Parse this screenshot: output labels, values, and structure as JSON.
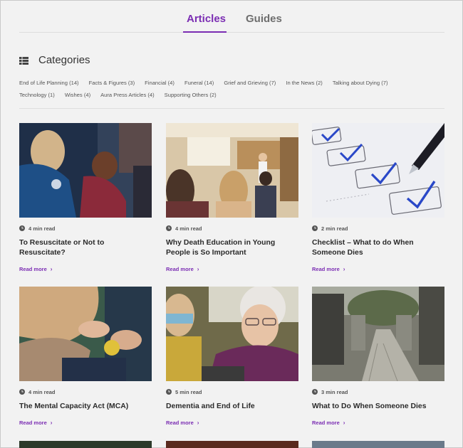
{
  "tabs": [
    {
      "label": "Articles",
      "active": true
    },
    {
      "label": "Guides",
      "active": false
    }
  ],
  "categories": {
    "title": "Categories",
    "icon": "grid-list-icon",
    "row1": [
      "End of Life Planning (14)",
      "Facts & Figures (3)",
      "Financial (4)",
      "Funeral (14)",
      "Grief and Grieving (7)",
      "In the News (2)",
      "Talking about Dying (7)"
    ],
    "row2": [
      "Technology (1)",
      "Wishes (4)",
      "Aura Press Articles (4)",
      "Supporting Others (2)"
    ]
  },
  "articles": [
    {
      "read_time": "4 min read",
      "title": "To Resuscitate or Not to Resuscitate?",
      "read_more": "Read more"
    },
    {
      "read_time": "4 min read",
      "title": "Why Death Education in Young People is So Important",
      "read_more": "Read more"
    },
    {
      "read_time": "2 min read",
      "title": "Checklist – What to do When Someone Dies",
      "read_more": "Read more"
    },
    {
      "read_time": "4 min read",
      "title": "The Mental Capacity Act (MCA)",
      "read_more": "Read more"
    },
    {
      "read_time": "5 min read",
      "title": "Dementia and End of Life",
      "read_more": "Read more"
    },
    {
      "read_time": "3 min read",
      "title": "What to Do When Someone Dies",
      "read_more": "Read more"
    }
  ],
  "colors": {
    "accent": "#7b2db3",
    "background": "#f2f2f2"
  }
}
